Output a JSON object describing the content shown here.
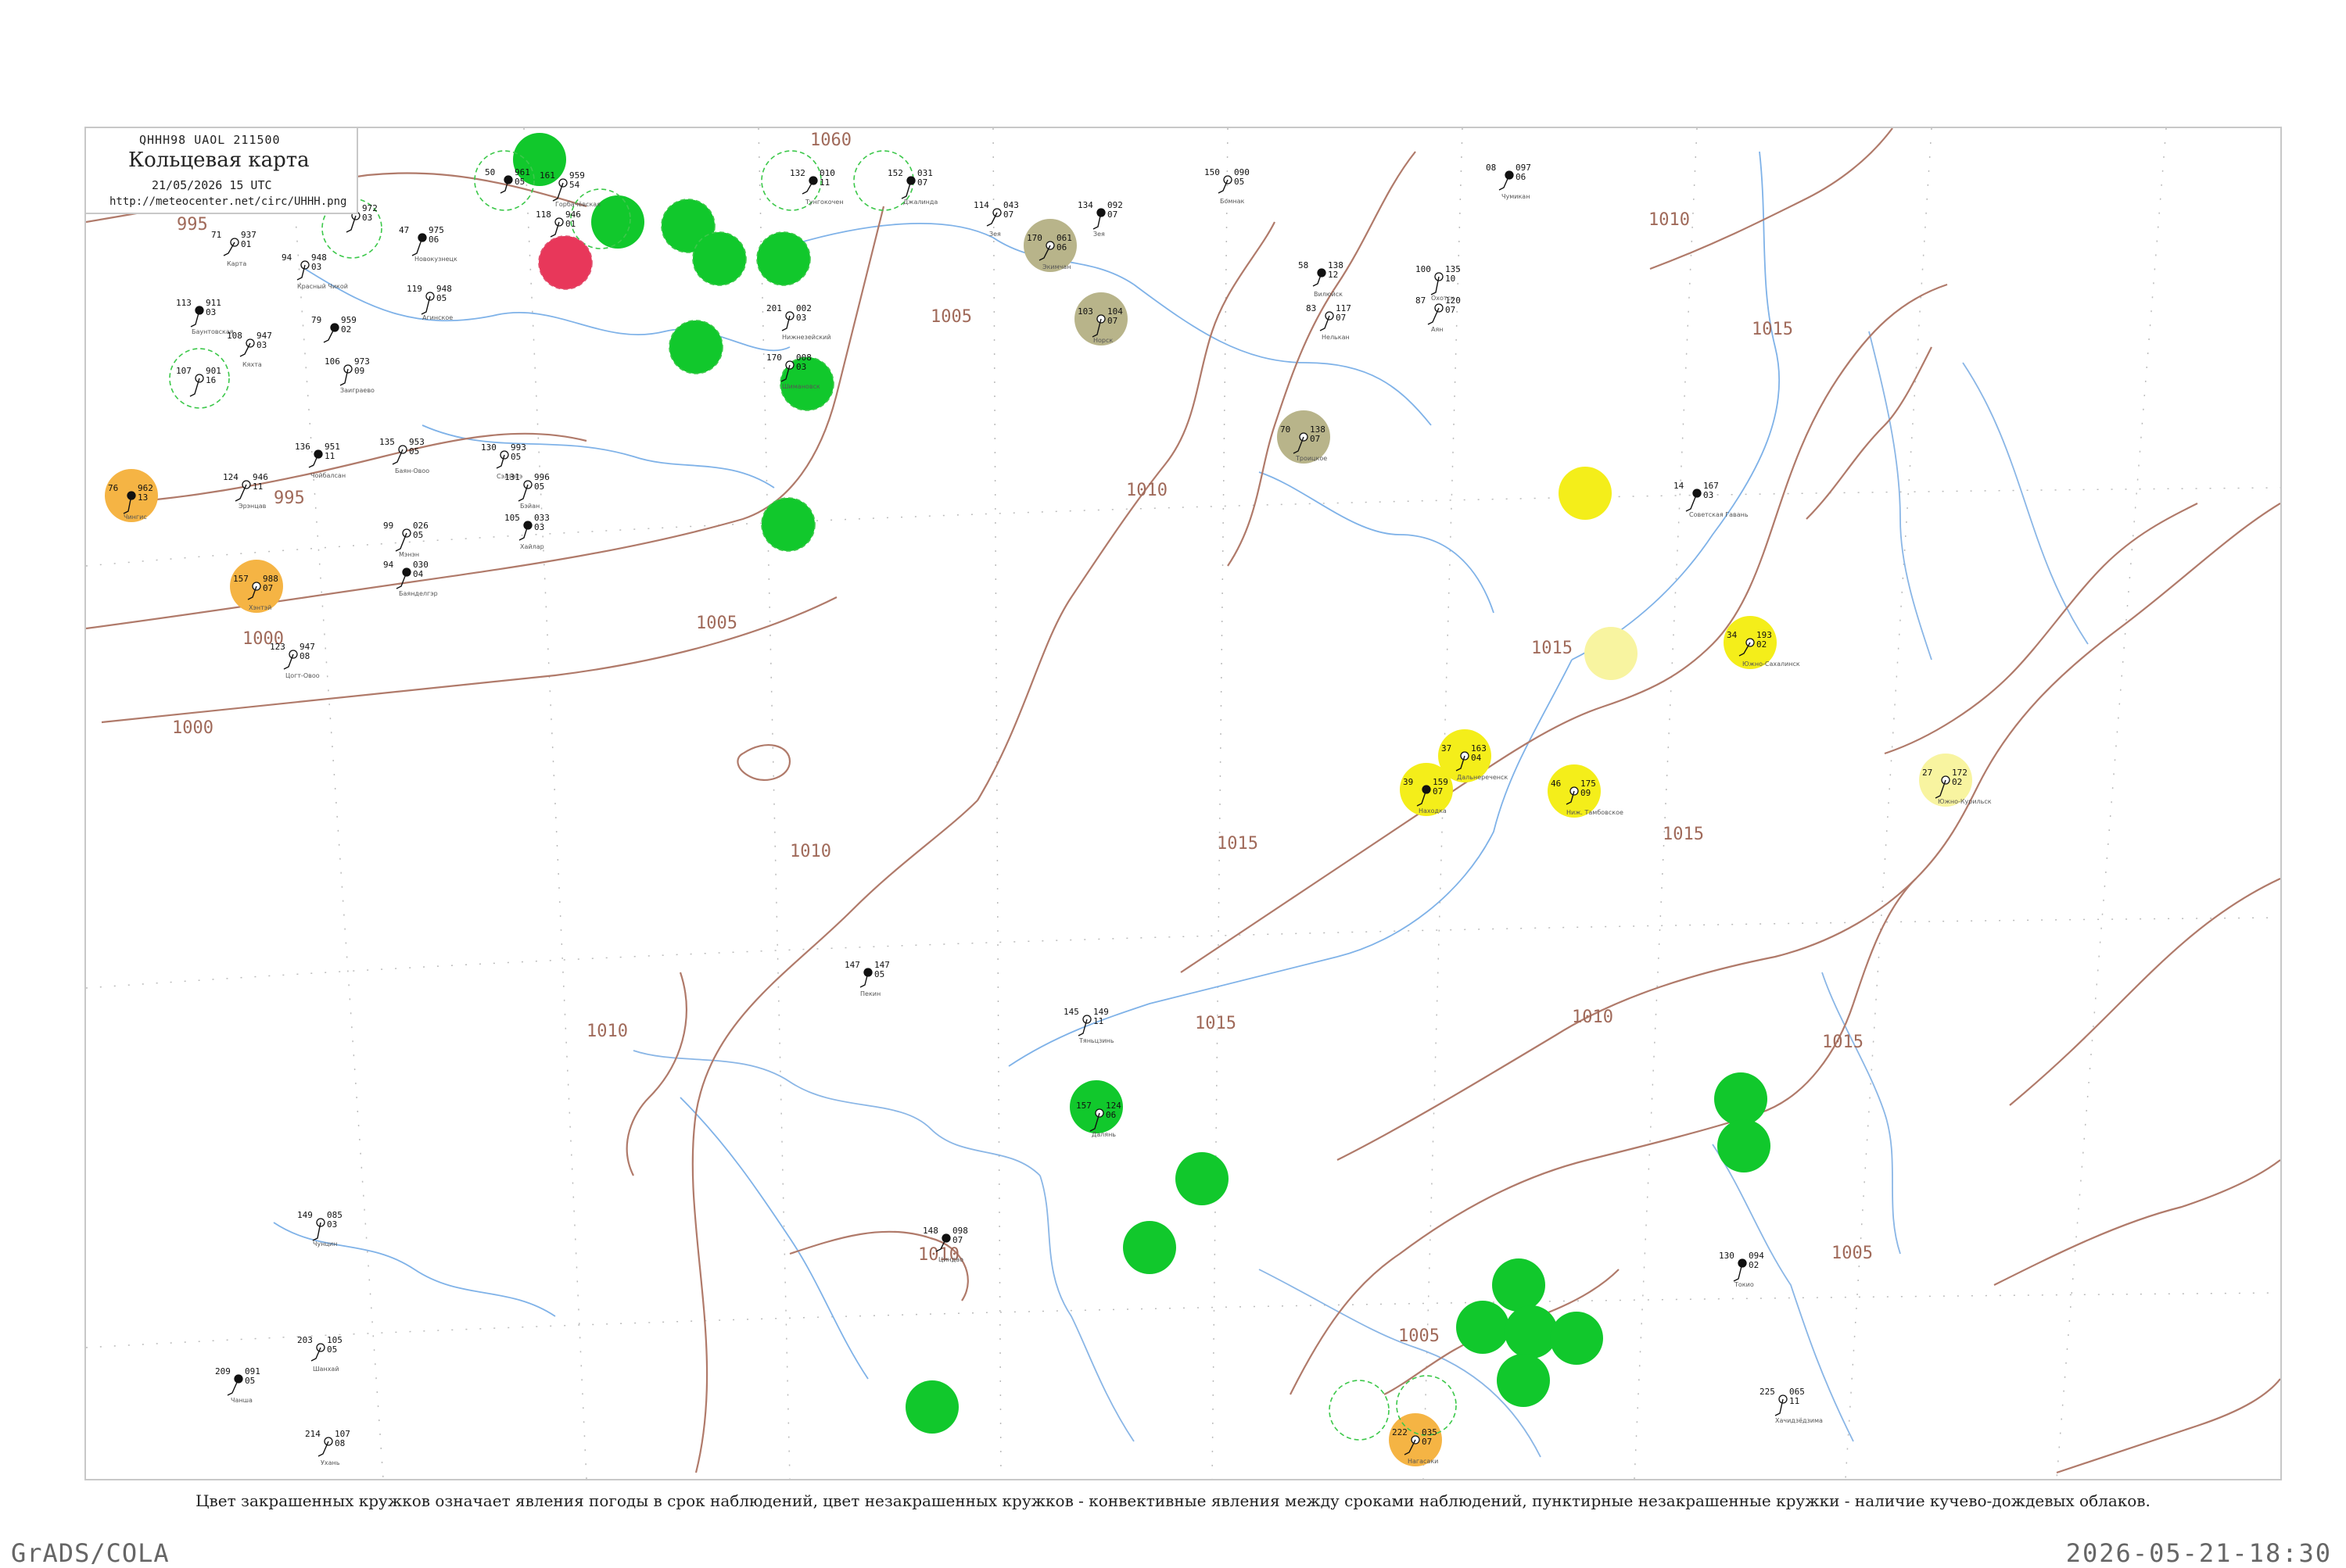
{
  "header": {
    "code": "QHHH98  UAOL  211500",
    "title": "Кольцевая карта",
    "datetime": "21/05/2026 15 UTC",
    "url": "http://meteocenter.net/circ/UHHH.png"
  },
  "caption": "Цвет закрашенных кружков означает явления погоды в срок наблюдений, цвет незакрашенных кружков - конвективные явления между сроками наблюдений, пунктирные незакрашенные кружки - наличие кучево-дождевых облаков.",
  "footer": {
    "left": "GrADS/COLA",
    "right": "2026-05-21-18:30"
  },
  "colors": {
    "isobar": "#b07a6a",
    "river": "#7fb2e8",
    "rain_green": "#11c82c",
    "thunder_red": "#e8375a",
    "fog_yellow": "#f4ee1a",
    "haze_pale_yellow": "#f8f4a0",
    "shower_orange": "#f5b444",
    "olive_dust": "#b8b48a"
  },
  "isobar_labels": [
    "995",
    "995",
    "1000",
    "1000",
    "1005",
    "1005",
    "1005",
    "1005",
    "1010",
    "1010",
    "1010",
    "1010",
    "1010",
    "1010",
    "1015",
    "1015",
    "1015",
    "1015",
    "1015",
    "1015",
    "1060"
  ],
  "stations": [
    {
      "p": "961",
      "t": "05",
      "d": "50",
      "name": ""
    },
    {
      "p": "946",
      "t": "01",
      "d": "118",
      "name": ""
    },
    {
      "p": "972",
      "t": "03",
      "d": "42",
      "name": ""
    },
    {
      "p": "975",
      "t": "06",
      "d": "47",
      "name": "Новокузнецк"
    },
    {
      "p": "937",
      "t": "01",
      "d": "71",
      "name": "Карта"
    },
    {
      "p": "948",
      "t": "03",
      "d": "94",
      "name": "Красный Чикой"
    },
    {
      "p": "911",
      "t": "03",
      "d": "113",
      "name": "Баунтовская"
    },
    {
      "p": "901",
      "t": "16",
      "d": "107",
      "name": ""
    },
    {
      "p": "947",
      "t": "03",
      "d": "108",
      "name": "Кяхта"
    },
    {
      "p": "959",
      "t": "02",
      "d": "79",
      "name": ""
    },
    {
      "p": "973",
      "t": "09",
      "d": "106",
      "name": "Заиграево"
    },
    {
      "p": "948",
      "t": "05",
      "d": "119",
      "name": "Агинское"
    },
    {
      "p": "951",
      "t": "11",
      "d": "136",
      "name": "Чойбалсан"
    },
    {
      "p": "953",
      "t": "05",
      "d": "135",
      "name": "Баян-Овоо"
    },
    {
      "p": "946",
      "t": "11",
      "d": "124",
      "name": "Эрэнцав"
    },
    {
      "p": "962",
      "t": "13",
      "d": "76",
      "name": "Чингис"
    },
    {
      "p": "988",
      "t": "07",
      "d": "157",
      "name": "Хэнтэй"
    },
    {
      "p": "947",
      "t": "08",
      "d": "123",
      "name": "Цогт-Овоо"
    },
    {
      "p": "030",
      "t": "04",
      "d": "94",
      "name": "Баянделгэр"
    },
    {
      "p": "026",
      "t": "05",
      "d": "99",
      "name": "Мэнэн"
    },
    {
      "p": "993",
      "t": "05",
      "d": "130",
      "name": "Сэлэнгэ"
    },
    {
      "p": "033",
      "t": "03",
      "d": "105",
      "name": "Хайлар"
    },
    {
      "p": "996",
      "t": "05",
      "d": "131",
      "name": "Бэйан"
    },
    {
      "p": "959",
      "t": "54",
      "d": "161",
      "name": "Горбачёвская"
    },
    {
      "p": "010",
      "t": "11",
      "d": "132",
      "name": "Тунгокочен"
    },
    {
      "p": "002",
      "t": "03",
      "d": "201",
      "name": "Нижнезейский"
    },
    {
      "p": "008",
      "t": "03",
      "d": "170",
      "name": "Шимановск"
    },
    {
      "p": "031",
      "t": "07",
      "d": "152",
      "name": "Джалинда"
    },
    {
      "p": "043",
      "t": "07",
      "d": "114",
      "name": "Зея"
    },
    {
      "p": "061",
      "t": "06",
      "d": "170",
      "name": "Экимчан"
    },
    {
      "p": "092",
      "t": "07",
      "d": "134",
      "name": "Зея"
    },
    {
      "p": "104",
      "t": "07",
      "d": "103",
      "name": "Норск"
    },
    {
      "p": "090",
      "t": "05",
      "d": "150",
      "name": "Бомнак"
    },
    {
      "p": "097",
      "t": "06",
      "d": "08",
      "name": "Чумикан"
    },
    {
      "p": "120",
      "t": "07",
      "d": "87",
      "name": "Аян"
    },
    {
      "p": "135",
      "t": "10",
      "d": "100",
      "name": "Охотск"
    },
    {
      "p": "138",
      "t": "12",
      "d": "58",
      "name": "Вилюйск"
    },
    {
      "p": "117",
      "t": "07",
      "d": "83",
      "name": "Нелькан"
    },
    {
      "p": "138",
      "t": "07",
      "d": "70",
      "name": "Троицкое"
    },
    {
      "p": "167",
      "t": "03",
      "d": "14",
      "name": "Советская Гавань"
    },
    {
      "p": "175",
      "t": "09",
      "d": "46",
      "name": "Ниж. Тамбовское"
    },
    {
      "p": "163",
      "t": "04",
      "d": "37",
      "name": "Дальнереченск"
    },
    {
      "p": "159",
      "t": "07",
      "d": "39",
      "name": "Находка"
    },
    {
      "p": "172",
      "t": "02",
      "d": "27",
      "name": "Южно-Курильск"
    },
    {
      "p": "193",
      "t": "02",
      "d": "34",
      "name": "Южно-Сахалинск"
    },
    {
      "p": "147",
      "t": "05",
      "d": "147",
      "name": "Пекин"
    },
    {
      "p": "149",
      "t": "11",
      "d": "145",
      "name": "Тяньцзинь"
    },
    {
      "p": "124",
      "t": "06",
      "d": "157",
      "name": "Далянь"
    },
    {
      "p": "098",
      "t": "07",
      "d": "148",
      "name": "Циндао"
    },
    {
      "p": "035",
      "t": "07",
      "d": "222",
      "name": "Нагасаки"
    },
    {
      "p": "065",
      "t": "11",
      "d": "225",
      "name": "Хачидзёдзима"
    },
    {
      "p": "094",
      "t": "02",
      "d": "130",
      "name": "Токио"
    },
    {
      "p": "105",
      "t": "05",
      "d": "203",
      "name": "Шанхай"
    },
    {
      "p": "107",
      "t": "08",
      "d": "214",
      "name": "Ухань"
    },
    {
      "p": "091",
      "t": "05",
      "d": "209",
      "name": "Чанша"
    },
    {
      "p": "085",
      "t": "03",
      "d": "149",
      "name": "Чунцин"
    }
  ]
}
